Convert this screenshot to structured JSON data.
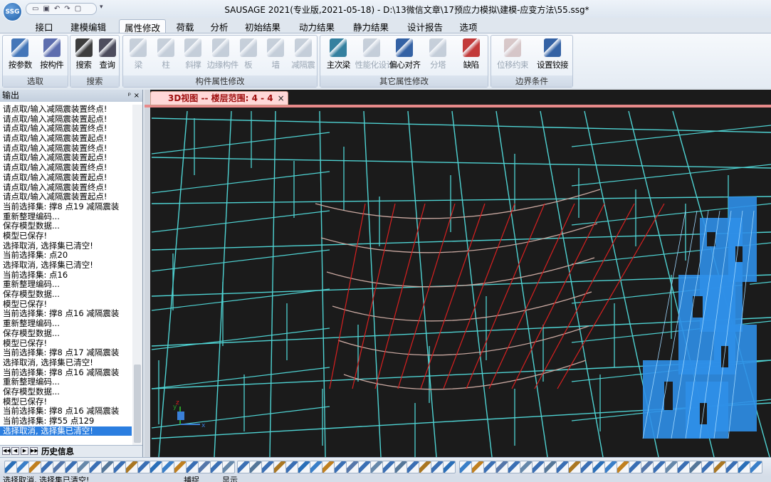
{
  "window": {
    "logo": "SSG",
    "title": "SAUSAGE 2021(专业版,2021-05-18) - D:\\13微信文章\\17预应力模拟\\建模-应变方法\\55.ssg*"
  },
  "menu": {
    "tabs": [
      "接口",
      "建模编辑",
      "属性修改",
      "荷载",
      "分析",
      "初始结果",
      "动力结果",
      "静力结果",
      "设计报告",
      "选项"
    ],
    "active": "属性修改"
  },
  "ribbon": {
    "groups": [
      {
        "label": "选取",
        "buttons": [
          {
            "label": "按参数",
            "icon": "cylinder-icon",
            "enabled": true
          },
          {
            "label": "按构件",
            "icon": "frame-icon",
            "enabled": true
          }
        ]
      },
      {
        "label": "搜索",
        "buttons": [
          {
            "label": "搜索",
            "icon": "magnifier-icon",
            "enabled": true
          },
          {
            "label": "查询",
            "icon": "query-icon",
            "enabled": true
          }
        ]
      },
      {
        "label": "构件属性修改",
        "buttons": [
          {
            "label": "梁",
            "icon": "beam-icon",
            "enabled": false
          },
          {
            "label": "柱",
            "icon": "column-icon",
            "enabled": false
          },
          {
            "label": "斜撑",
            "icon": "brace-icon",
            "enabled": false
          },
          {
            "label": "边缘构件",
            "icon": "edge-member-icon",
            "enabled": false
          },
          {
            "label": "板",
            "icon": "slab-icon",
            "enabled": false
          },
          {
            "label": "墙",
            "icon": "wall-icon",
            "enabled": false
          },
          {
            "label": "减隔震",
            "icon": "damper-icon",
            "enabled": false
          }
        ]
      },
      {
        "label": "其它属性修改",
        "buttons": [
          {
            "label": "主次梁",
            "icon": "main-secondary-beam-icon",
            "enabled": true
          },
          {
            "label": "性能化设计",
            "icon": "performance-design-icon",
            "enabled": false
          },
          {
            "label": "偏心对齐",
            "icon": "eccentric-align-icon",
            "enabled": true
          },
          {
            "label": "分塔",
            "icon": "tower-icon",
            "enabled": false
          },
          {
            "label": "缺陷",
            "icon": "defect-icon",
            "enabled": true
          }
        ]
      },
      {
        "label": "边界条件",
        "buttons": [
          {
            "label": "位移约束",
            "icon": "displacement-constraint-icon",
            "enabled": false
          },
          {
            "label": "设置铰接",
            "icon": "hinge-icon",
            "enabled": true
          }
        ]
      }
    ]
  },
  "output": {
    "title": "输出",
    "pin": "ᵖ",
    "close": "×",
    "lines": [
      "请点取/输入减隔震装置终点!",
      "请点取/输入减隔震装置起点!",
      "请点取/输入减隔震装置终点!",
      "请点取/输入减隔震装置起点!",
      "请点取/输入减隔震装置终点!",
      "请点取/输入减隔震装置起点!",
      "请点取/输入减隔震装置终点!",
      "请点取/输入减隔震装置起点!",
      "请点取/输入减隔震装置终点!",
      "请点取/输入减隔震装置起点!",
      "当前选择集:  撑8 点19 减隔震装",
      "重新整理编码...",
      "保存模型数据...",
      "模型已保存!",
      "选择取消, 选择集已清空!",
      "当前选择集:  点20",
      "选择取消, 选择集已清空!",
      "当前选择集:  点16",
      "重新整理编码...",
      "保存模型数据...",
      "模型已保存!",
      "当前选择集:  撑8 点16 减隔震装",
      "重新整理编码...",
      "保存模型数据...",
      "模型已保存!",
      "当前选择集:  撑8 点17 减隔震装",
      "选择取消, 选择集已清空!",
      "当前选择集:  撑8 点16 减隔震装",
      "重新整理编码...",
      "保存模型数据...",
      "模型已保存!",
      "当前选择集:  撑8 点16 减隔震装",
      "当前选择集:  撑55 点129",
      "选择取消, 选择集已清空!"
    ],
    "selected_index": 33,
    "history_tab": "历史信息",
    "nav": [
      "◀◀",
      "◀",
      "▶",
      "▶▶"
    ]
  },
  "viewport": {
    "tab_title": "3D视图 -- 楼层范围: 4 - 4",
    "tab_close": "×",
    "axis_labels": {
      "x": "x",
      "y": "y",
      "z": "z"
    },
    "colors": {
      "background": "#1b1b1b",
      "grid": "#4fd3d3",
      "tendon": "#d92020",
      "wall": "#2f8fe8",
      "curve": "#c9a8a0"
    }
  },
  "status": {
    "left": "选择取消, 选择集已清空!",
    "mid1": "捕捉",
    "mid2": "显示"
  }
}
